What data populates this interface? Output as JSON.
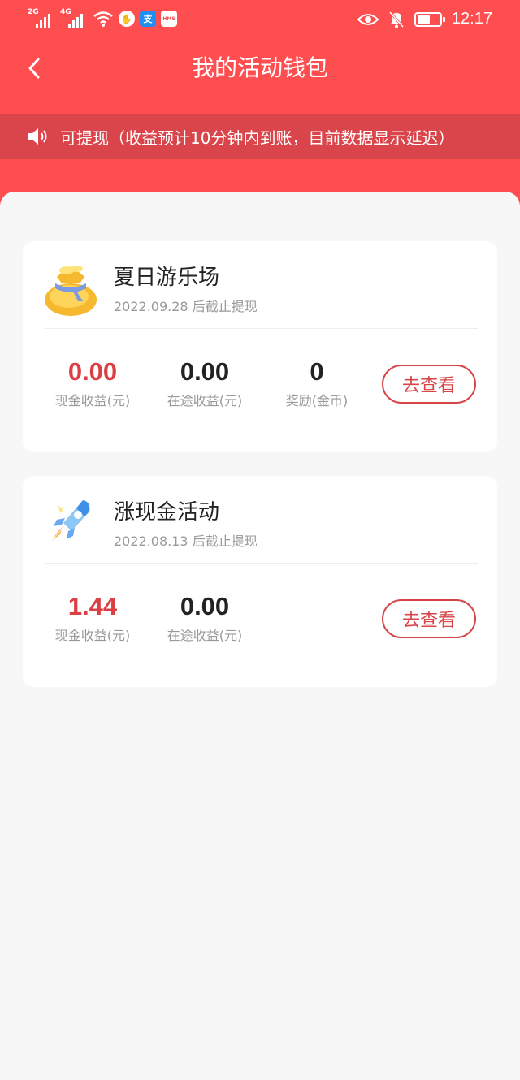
{
  "status_bar": {
    "sim1_network": "2G",
    "sim2_network": "4G",
    "time": "12:17",
    "icons": [
      "signal-icon",
      "signal-icon",
      "wifi-icon",
      "hand-app-icon",
      "alipay-icon",
      "hms-icon",
      "eye-icon",
      "bell-off-icon",
      "battery-icon"
    ],
    "hms_label": "HMS",
    "alipay_label": "支"
  },
  "nav": {
    "title": "我的活动钱包",
    "back_icon": "chevron-left-icon"
  },
  "notice": {
    "icon": "speaker-icon",
    "text": "可提现（收益预计10分钟内到账，目前数据显示延迟）"
  },
  "cards": [
    {
      "title": "夏日游乐场",
      "subtitle": "2022.09.28 后截止提现",
      "icon": "money-bag-icon",
      "stats": [
        {
          "value": "0.00",
          "label": "现金收益(元)"
        },
        {
          "value": "0.00",
          "label": "在途收益(元)"
        },
        {
          "value": "0",
          "label": "奖励(金币)"
        }
      ],
      "button": "去查看"
    },
    {
      "title": "涨现金活动",
      "subtitle": "2022.08.13 后截止提现",
      "icon": "rocket-icon",
      "stats": [
        {
          "value": "1.44",
          "label": "现金收益(元)"
        },
        {
          "value": "0.00",
          "label": "在途收益(元)"
        }
      ],
      "button": "去查看"
    }
  ],
  "colors": {
    "brand_red": "#ff4e50",
    "notice_bg": "#d9454a",
    "accent_red": "#dc3f43",
    "background": "#f7f7f7"
  }
}
